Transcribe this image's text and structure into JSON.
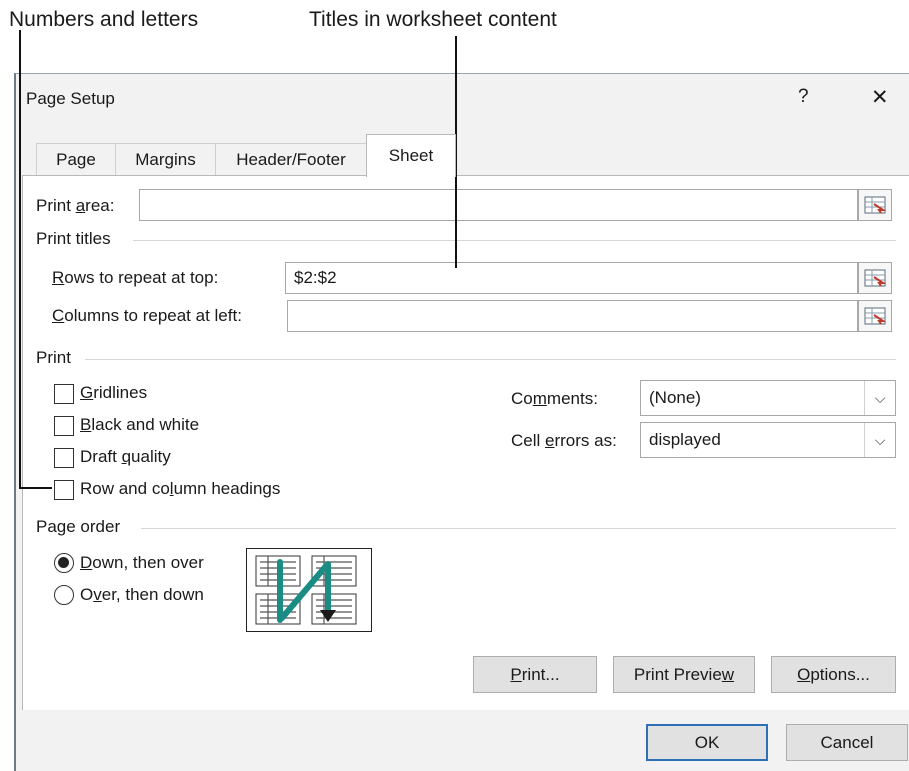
{
  "callouts": {
    "numbers_letters": "Numbers and letters",
    "titles_content": "Titles in worksheet content"
  },
  "window": {
    "title": "Page Setup",
    "help": "?",
    "close": "✕"
  },
  "tabs": [
    {
      "label": "Page",
      "active": false
    },
    {
      "label": "Margins",
      "active": false
    },
    {
      "label": "Header/Footer",
      "active": false
    },
    {
      "label": "Sheet",
      "active": true
    }
  ],
  "print_area": {
    "label_pre": "Print ",
    "label_key": "a",
    "label_post": "rea:",
    "value": ""
  },
  "print_titles": {
    "heading": "Print titles",
    "rows": {
      "label_key": "R",
      "label_post": "ows to repeat at top:",
      "value": "$2:$2"
    },
    "columns": {
      "label_key": "C",
      "label_post": "olumns to repeat at left:",
      "value": ""
    }
  },
  "print": {
    "heading": "Print",
    "gridlines": {
      "pre": "",
      "key": "G",
      "post": "ridlines",
      "checked": false
    },
    "black_white": {
      "pre": "",
      "key": "B",
      "post": "lack and white",
      "checked": false
    },
    "draft": {
      "pre": "Draft ",
      "key": "q",
      "post": "uality",
      "checked": false
    },
    "headings": {
      "pre": "Row and co",
      "key": "l",
      "post": "umn headings",
      "checked": false
    },
    "comments": {
      "pre": "Co",
      "key": "m",
      "post": "ments:",
      "value": "(None)"
    },
    "cell_errors": {
      "pre": "Cell ",
      "key": "e",
      "post": "rrors as:",
      "value": "displayed"
    }
  },
  "page_order": {
    "heading": "Page order",
    "down_over": {
      "pre": "",
      "key": "D",
      "post": "own, then over",
      "selected": true
    },
    "over_down": {
      "pre": "O",
      "key": "v",
      "post": "er, then down",
      "selected": false
    }
  },
  "buttons": {
    "print": {
      "pre": "",
      "key": "P",
      "post": "rint..."
    },
    "preview": {
      "pre": "Print Previe",
      "key": "w",
      "post": ""
    },
    "options": {
      "pre": "",
      "key": "O",
      "post": "ptions..."
    },
    "ok": "OK",
    "cancel": "Cancel"
  },
  "colors": {
    "accent": "#2f6fb5",
    "arrow": "#1a8c84"
  }
}
